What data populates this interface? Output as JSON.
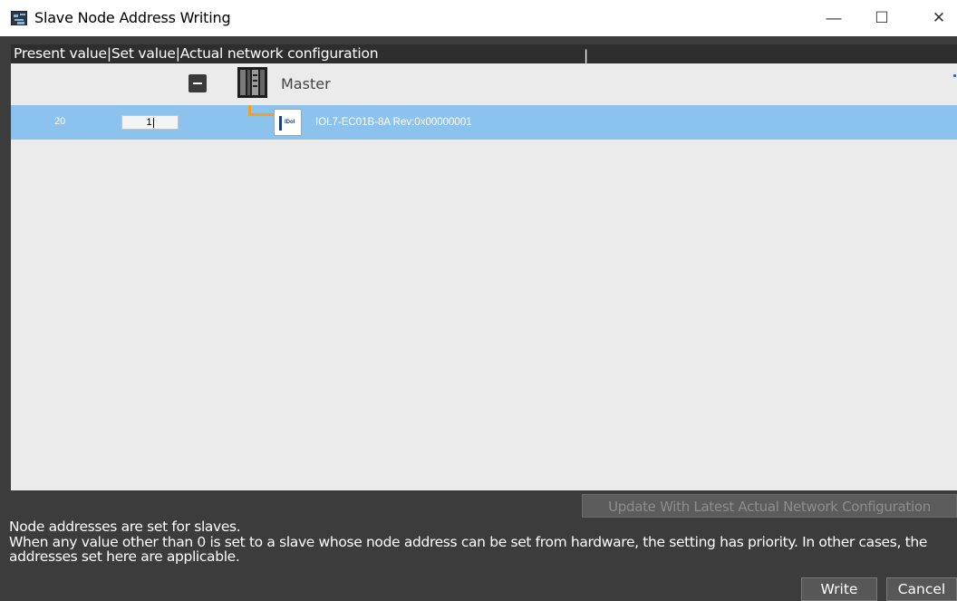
{
  "window": {
    "title": "Slave Node Address Writing",
    "app_icon": "network-tool-icon",
    "minimize_icon": "minimize-icon",
    "maximize_icon": "maximize-icon",
    "close_icon": "close-icon",
    "minimize_glyph": "—",
    "maximize_glyph": "☐",
    "close_glyph": "✕"
  },
  "grid": {
    "header": "Present value|Set value|Actual network configuration",
    "header_separator": "|",
    "master": {
      "label": "Master",
      "icon": "plc-controller-icon",
      "collapse_icon": "collapse-icon"
    },
    "slaves": [
      {
        "present_value": "20",
        "set_value": "1",
        "device_icon": "io-link-device-icon",
        "device_logo": "IDoI",
        "label": "IOL7-EC01B-8A Rev:0x00000001"
      }
    ]
  },
  "update_button": {
    "label": "Update With Latest Actual Network Configuration"
  },
  "info": {
    "line1": "Node addresses are set for slaves.",
    "line2": "When any value other than 0 is set to a slave whose node address can be set from hardware, the setting has priority. In other cases, the",
    "line3": "addresses set here are applicable."
  },
  "buttons": {
    "write": "Write",
    "cancel": "Cancel"
  },
  "colors": {
    "selected_row": "#8cc2ee",
    "tree_line": "#f4a021",
    "header_bg": "#2e2e2e",
    "panel_bg": "#3c3c3c"
  }
}
